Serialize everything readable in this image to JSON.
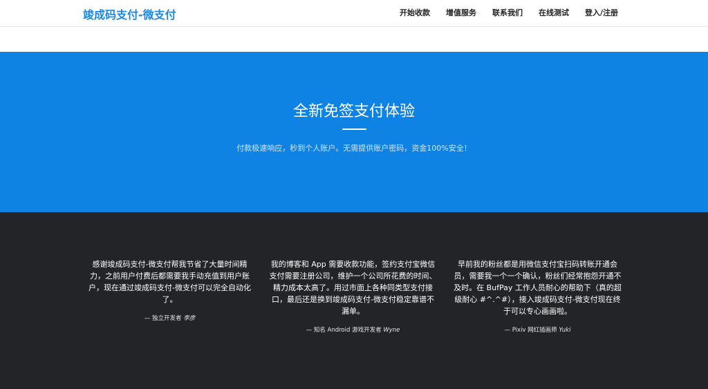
{
  "nav": {
    "brand": "竣成码支付-微支付",
    "items": [
      "开始收款",
      "增值服务",
      "联系我们",
      "在线测试",
      "登入/注册"
    ]
  },
  "hero": {
    "title": "全新免签支付体验",
    "subtitle": "付款极速响应，秒到个人账户。无需提供账户密码，资金100%安全！"
  },
  "testimonials": [
    {
      "quote": "感谢竣成码支付-微支付帮我节省了大量时间精力，之前用户付费后都需要我手动充值到用户账户，现在通过竣成码支付-微支付可以完全自动化了。",
      "role": "— 独立开发者",
      "author": "李彦"
    },
    {
      "quote": "我的博客和 App 需要收款功能，签约支付宝微信支付需要注册公司，维护一个公司所花费的时间、精力成本太高了。用过市面上各种同类型支付接口，最后还是换到竣成码支付-微支付稳定靠谱不漏单。",
      "role": "— 知名 Android 游戏开发者",
      "author": "Wyne"
    },
    {
      "quote": "早前我的粉丝都是用微信支付宝扫码转账开通会员，需要我一个一个确认，粉丝们经常抱怨开通不及时。在 BufPay 工作人员耐心的帮助下（真的超级耐心 #^.^#），接入竣成码支付-微支付现在终于可以专心画画啦。",
      "role": "— Pixiv 网红插画师",
      "author": "Yuki"
    }
  ]
}
